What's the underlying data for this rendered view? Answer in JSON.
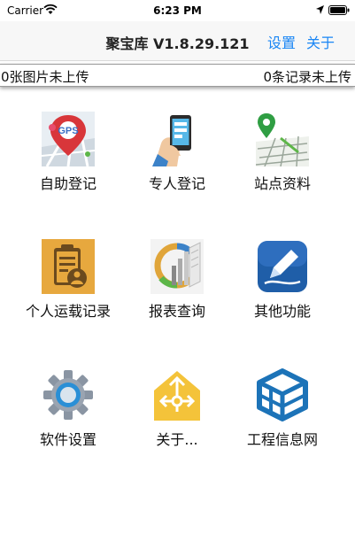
{
  "status_bar": {
    "carrier": "Carrier",
    "time": "6:23 PM"
  },
  "nav": {
    "title": "聚宝库 V1.8.29.121",
    "settings_label": "设置",
    "about_label": "关于",
    "accent_color": "#1a86f5"
  },
  "upload_status": {
    "images_pending": "0张图片未上传",
    "records_pending": "0条记录未上传"
  },
  "menu": {
    "items": [
      {
        "label": "自助登记",
        "icon": "gps-map-icon"
      },
      {
        "label": "专人登记",
        "icon": "phone-in-hand-icon"
      },
      {
        "label": "站点资料",
        "icon": "map-pin-icon"
      },
      {
        "label": "个人运载记录",
        "icon": "clipboard-person-icon"
      },
      {
        "label": "报表查询",
        "icon": "report-chart-icon"
      },
      {
        "label": "其他功能",
        "icon": "pen-app-icon"
      },
      {
        "label": "软件设置",
        "icon": "gear-icon"
      },
      {
        "label": "关于...",
        "icon": "house-arrows-icon"
      },
      {
        "label": "工程信息网",
        "icon": "cube-network-icon"
      }
    ]
  }
}
